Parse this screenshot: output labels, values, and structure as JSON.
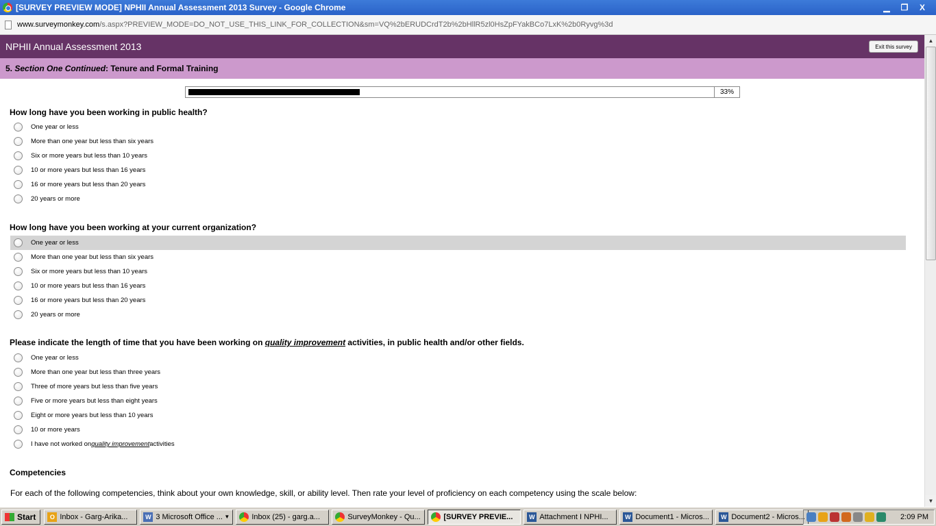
{
  "window": {
    "title": "[SURVEY PREVIEW MODE] NPHII Annual Assessment 2013 Survey - Google Chrome",
    "url_host": "www.surveymonkey.com",
    "url_path": "/s.aspx?PREVIEW_MODE=DO_NOT_USE_THIS_LINK_FOR_COLLECTION&sm=VQ%2bERUDCrdT2b%2bHllR5zl0HsZpFYakBCo7LxK%2b0Ryvg%3d",
    "minimize": "▁",
    "maximize": "❐",
    "close": "X"
  },
  "survey": {
    "title": "NPHII Annual Assessment 2013",
    "exit_label": "Exit this survey",
    "section_number": "5.",
    "section_italic": "Section One Continued",
    "section_rest": ": Tenure and Formal Training",
    "progress_percent": 33,
    "progress_label": "33%"
  },
  "questions": [
    {
      "text": "How long have you been working in public health?",
      "options": [
        "One year or less",
        "More than one year but less than six years",
        "Six or more years but less than 10 years",
        "10 or more years but less than 16 years",
        "16 or more years but less than 20 years",
        "20 years or more"
      ]
    },
    {
      "text": "How long have you been working at your current organization?",
      "options": [
        "One year or less",
        "More than one year but less than six years",
        "Six or more years but less than 10 years",
        "10 or more years but less than 16 years",
        "16 or more years but less than 20 years",
        "20 years or more"
      ]
    },
    {
      "text_before": "Please indicate the length of time that you have been working on ",
      "text_emph": "quality improvement",
      "text_after": " activities, in public health and/or other fields.",
      "options": [
        "One year or less",
        "More than one year but less than three years",
        "Three of more years but less than five years",
        "Five or more years but less than eight years",
        "Eight or more years but less than 10 years",
        "10 or more years"
      ],
      "last_option_before": "I have not worked on ",
      "last_option_emph": "quality improvement",
      "last_option_after": " activities"
    }
  ],
  "competencies": {
    "heading": "Competencies",
    "text": "For each of the following competencies, think about your own knowledge, skill, or ability level. Then rate your level of proficiency on each competency using the scale below:"
  },
  "taskbar": {
    "start": "Start",
    "tasks": [
      "Inbox - Garg-Arika...",
      "3 Microsoft Office ...",
      "Inbox (25) - garg.a...",
      "SurveyMonkey - Qu...",
      "[SURVEY PREVIE...",
      "Attachment I  NPHI...",
      "Document1 - Micros...",
      "Document2 - Micros..."
    ],
    "clock": "2:09 PM"
  }
}
